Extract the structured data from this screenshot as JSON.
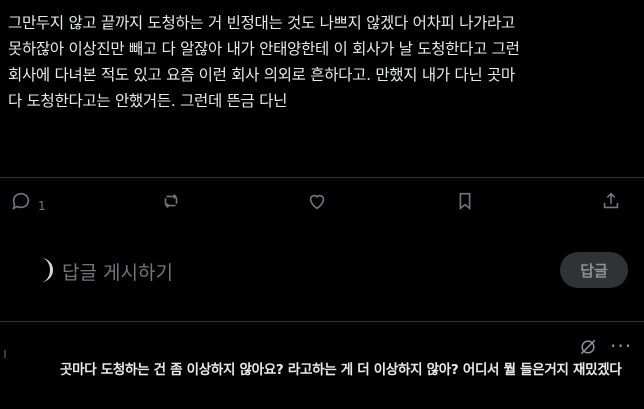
{
  "post": {
    "text": "그만두지 않고 끝까지 도청하는 거 빈정대는 것도 나쁘지 않겠다 어차피 나가라고\n못하잖아 이상진만 빼고 다 알잖아 내가 안태양한테 이 회사가 날 도청한다고 그런\n회사에 다녀본 적도 있고 요즘 이런 회사 의외로 흔하다고. 만했지 내가 다닌 곳마\n다 도청한다고는 안했거든. 그런데 뜬금 다닌"
  },
  "actions": {
    "reply_icon": "comment-icon",
    "reply_count": "1",
    "repost_icon": "repost-icon",
    "like_icon": "heart-icon",
    "bookmark_icon": "bookmark-icon",
    "share_icon": "share-icon"
  },
  "reply_box": {
    "placeholder": "답글 게시하기",
    "button_label": "답글"
  },
  "comment": {
    "text": "곳마다 도청하는 건 좀 이상하지 않아요? 라고하는 게 더 이상하지 않아? 어디서 뭘 들은거지 재밌겠다",
    "more_label": "···"
  },
  "colors": {
    "background": "#000000",
    "text": "#e7e9ea",
    "muted": "#71767b",
    "divider": "#2f3336"
  }
}
